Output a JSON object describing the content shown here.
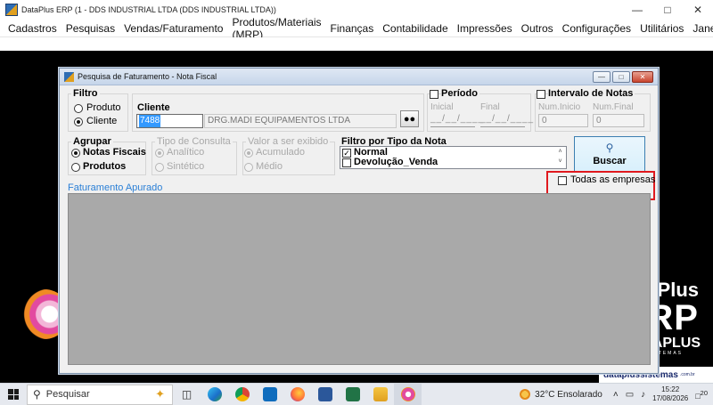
{
  "app": {
    "title": "DataPlus ERP (1 - DDS INDUSTRIAL LTDA   (DDS INDUSTRIAL LTDA))"
  },
  "menu": [
    "Cadastros",
    "Pesquisas",
    "Vendas/Faturamento",
    "Produtos/Materiais (MRP)",
    "Finanças",
    "Contabilidade",
    "Impressões",
    "Outros",
    "Configurações",
    "Utilitários",
    "Janelas"
  ],
  "dialog": {
    "title": "Pesquisa de Faturamento - Nota Fiscal",
    "filtro": {
      "label": "Filtro",
      "options": [
        "Produto",
        "Cliente"
      ],
      "selected": "Cliente"
    },
    "cliente": {
      "label": "Cliente",
      "code": "7488",
      "name": "DRG.MADI EQUIPAMENTOS LTDA"
    },
    "periodo": {
      "label": "Período",
      "inicial_label": "Inicial",
      "final_label": "Final",
      "inicial_value": "__/__/____",
      "final_value": "__/__/____"
    },
    "intervalo": {
      "label": "Intervalo de Notas",
      "inicio_label": "Num.Inicio",
      "final_label": "Num.Final",
      "inicio_value": "0",
      "final_value": "0"
    },
    "agrupar": {
      "label": "Agrupar",
      "options": [
        "Notas Fiscais",
        "Produtos"
      ],
      "selected": "Notas Fiscais"
    },
    "tipo_consulta": {
      "label": "Tipo de Consulta",
      "options": [
        "Analítico",
        "Sintético"
      ],
      "selected": "Analítico",
      "enabled": false
    },
    "valor_exibido": {
      "label": "Valor a ser exibido",
      "options": [
        "Acumulado",
        "Médio"
      ],
      "selected": "Acumulado",
      "enabled": false
    },
    "filtro_tipo": {
      "label": "Filtro por Tipo da Nota",
      "items": [
        {
          "label": "Normal",
          "checked": true
        },
        {
          "label": "Devolução_Venda",
          "checked": false
        }
      ]
    },
    "buscar": {
      "label": "Buscar"
    },
    "todas_empresas": {
      "label": "Todas as empresas",
      "checked": false
    },
    "resultado": {
      "label": "Faturamento Apurado"
    }
  },
  "background": {
    "brand_plus": "Plus",
    "brand_rp": "RP",
    "brand_aplus": "APLUS",
    "brand_temas": "TEMAS",
    "brand_url": "dataplussistemas",
    "brand_url_suffix": ".com.br"
  },
  "taskbar": {
    "search_placeholder": "Pesquisar",
    "weather": "32°C  Ensolarado",
    "time": "15:22",
    "date": "17/08/2026",
    "notifications": "20"
  },
  "colors": {
    "accent": "#2a7fd6",
    "highlight": "#e0191e",
    "results_bg": "#a9a9a9",
    "selection": "#3399ff"
  }
}
